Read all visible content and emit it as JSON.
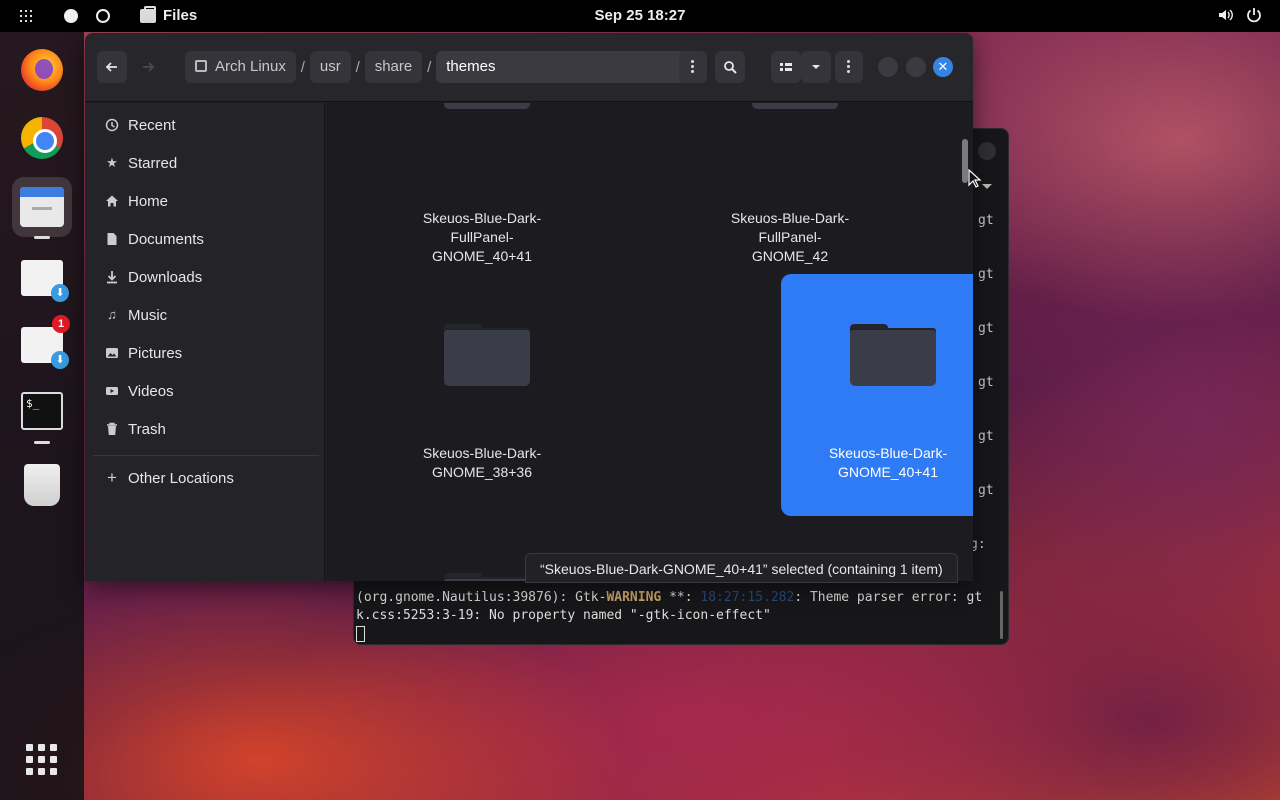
{
  "topbar": {
    "app_name": "Files",
    "clock": "Sep 25  18:27"
  },
  "dock": {
    "notification_count": "1",
    "terminal_glyph": "$_"
  },
  "files": {
    "path": [
      "Arch Linux",
      "usr",
      "share",
      "themes"
    ],
    "path_separator": "/",
    "sidebar": [
      {
        "label": "Recent",
        "icon": "clock-icon"
      },
      {
        "label": "Starred",
        "icon": "star-icon"
      },
      {
        "label": "Home",
        "icon": "home-icon"
      },
      {
        "label": "Documents",
        "icon": "document-icon"
      },
      {
        "label": "Downloads",
        "icon": "download-icon"
      },
      {
        "label": "Music",
        "icon": "music-icon"
      },
      {
        "label": "Pictures",
        "icon": "picture-icon"
      },
      {
        "label": "Videos",
        "icon": "video-icon"
      },
      {
        "label": "Trash",
        "icon": "trash-icon"
      },
      {
        "label": "Other Locations",
        "icon": "plus-icon"
      }
    ],
    "items": [
      {
        "label": "Skeuos-Blue-Dark-FullPanel-GNOME_40+41",
        "selected": false
      },
      {
        "label": "Skeuos-Blue-Dark-FullPanel-GNOME_42",
        "selected": false
      },
      {
        "label": "Skeuos-Blue-Dark-GNOME_38+36",
        "selected": false
      },
      {
        "label": "Skeuos-Blue-Dark-GNOME_40+41",
        "selected": true
      }
    ],
    "status": "“Skeuos-Blue-Dark-GNOME_40+41” selected  (containing 1 item)"
  },
  "terminal": {
    "gt_fragment": "gt",
    "g_fragment": "g:",
    "line1_prefix": "(org.gnome.Nautilus:39876): Gtk-",
    "line1_warn": "WARNING",
    "line1_mid": " **: ",
    "line1_ts": "18:27:15.282",
    "line1_suffix": ": Theme parser error: gt",
    "line2": "k.css:5253:3-19: No property named \"-gtk-icon-effect\""
  },
  "colors": {
    "accent": "#3584e4",
    "selection": "#2f7bf5",
    "warning": "#c9a46a"
  }
}
